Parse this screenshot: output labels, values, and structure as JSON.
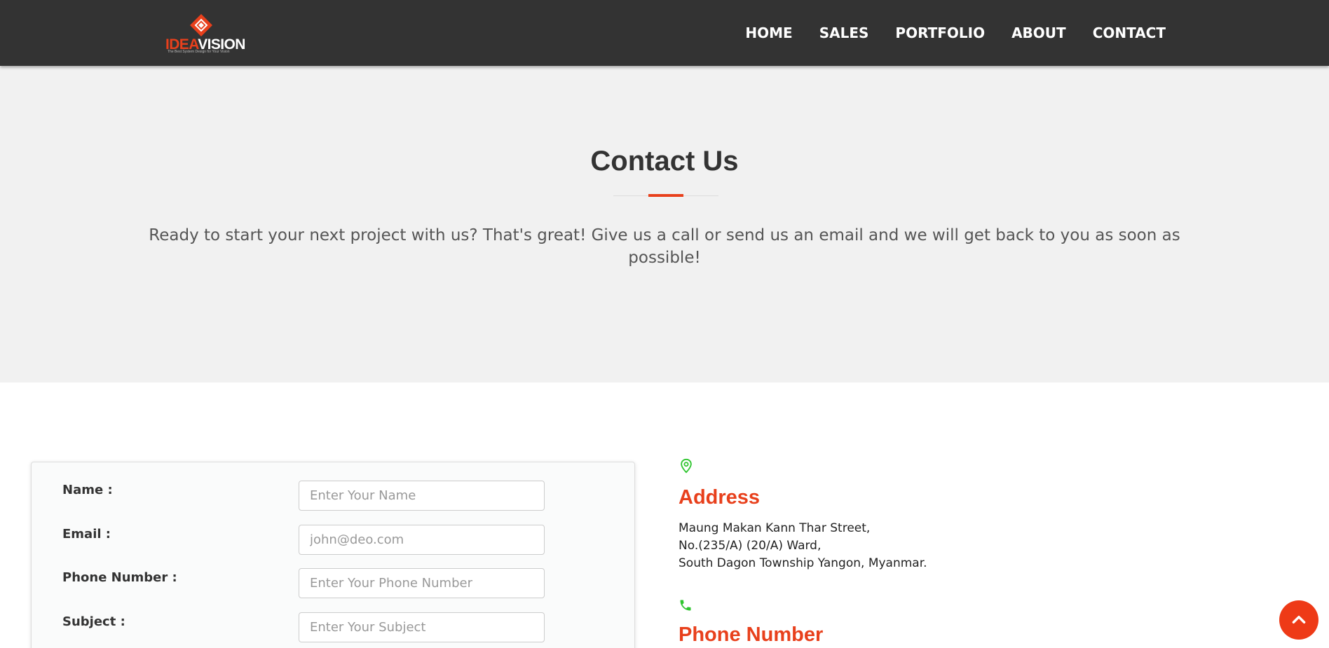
{
  "brand": {
    "name_part1": "IDEA",
    "name_part2": "VISION",
    "tagline": "The Best System Design for Your Vision",
    "accent_color": "#e8401c"
  },
  "nav": {
    "items": [
      {
        "label": "HOME"
      },
      {
        "label": "SALES"
      },
      {
        "label": "PORTFOLIO"
      },
      {
        "label": "ABOUT"
      },
      {
        "label": "CONTACT"
      }
    ]
  },
  "hero": {
    "title": "Contact Us",
    "text": "Ready to start your next project with us? That's great! Give us a call or send us an email and we will get back to you as soon as possible!"
  },
  "form": {
    "fields": [
      {
        "label": "Name :",
        "placeholder": "Enter Your Name",
        "value": ""
      },
      {
        "label": "Email :",
        "placeholder": "john@deo.com",
        "value": ""
      },
      {
        "label": "Phone Number :",
        "placeholder": "Enter Your Phone Number",
        "value": ""
      },
      {
        "label": "Subject :",
        "placeholder": "Enter Your Subject",
        "value": ""
      }
    ]
  },
  "info": {
    "address": {
      "icon": "map-pin-icon",
      "heading": "Address",
      "lines": [
        "Maung Makan Kann Thar Street,",
        "No.(235/A) (20/A) Ward,",
        "South Dagon Township Yangon, Myanmar."
      ]
    },
    "phone": {
      "icon": "phone-icon",
      "heading": "Phone Number"
    },
    "icon_color": "#2fc52f"
  },
  "scroll_top": {
    "icon": "chevron-up-icon",
    "color": "#ee3a17"
  }
}
